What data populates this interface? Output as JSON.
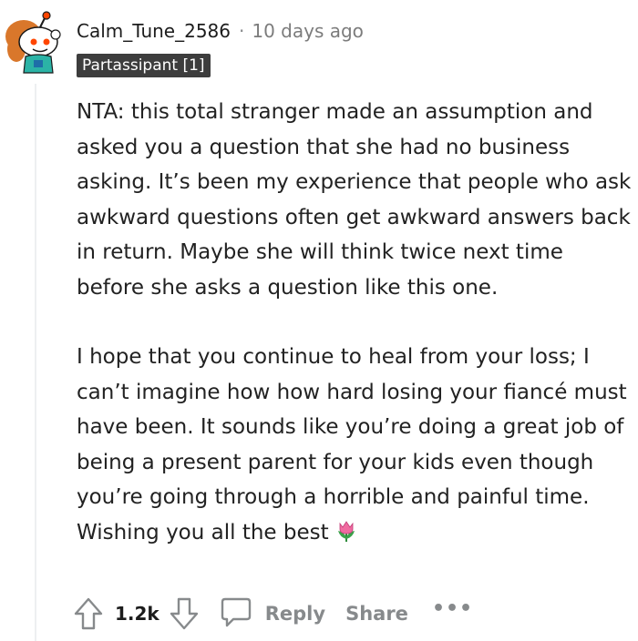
{
  "comment": {
    "author": "Calm_Tune_2586",
    "separator": "·",
    "timestamp": "10 days ago",
    "flair": "Partassipant [1]",
    "paragraphs": [
      "NTA: this total stranger made an assumption and asked you a question that she had no business asking. It’s been my experience that people who ask awkward questions often get awkward answers back in return. Maybe she will think twice next time before she asks a question like this one.",
      "I hope that you continue to heal from your loss; I can’t imagine how how hard losing your fiancé must have been. It sounds like you’re doing a great job of being a present parent for your kids even though you’re going through a horrible and painful time. Wishing you all the best"
    ],
    "emoji": "tulip-emoji"
  },
  "actions": {
    "score": "1.2k",
    "reply_label": "Reply",
    "share_label": "Share",
    "more_label": "•••"
  },
  "icons": {
    "upvote": "upvote-arrow-icon",
    "downvote": "downvote-arrow-icon",
    "reply": "speech-bubble-icon",
    "avatar": "snoo-avatar-icon"
  },
  "colors": {
    "flair_bg": "#3d3d3d",
    "muted": "#878a8c",
    "text": "#1c1c1c"
  }
}
